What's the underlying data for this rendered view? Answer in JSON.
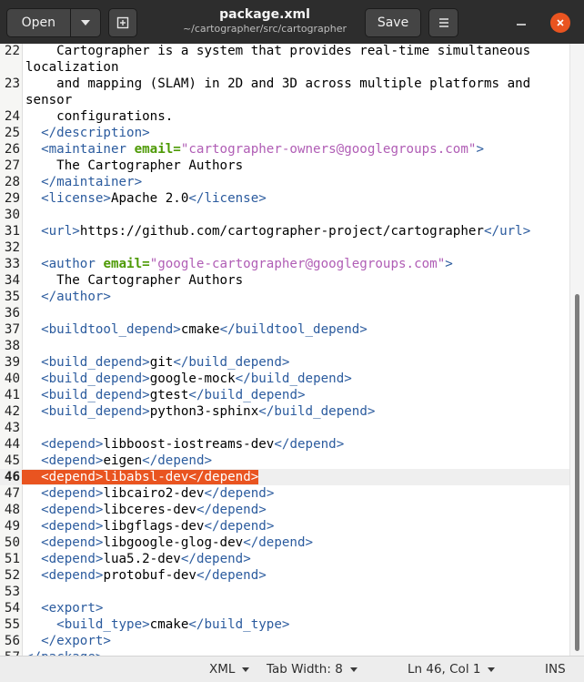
{
  "header": {
    "open_label": "Open",
    "save_label": "Save",
    "title": "package.xml",
    "subtitle": "~/cartographer/src/cartographer"
  },
  "editor": {
    "current_line": 46,
    "lines": [
      {
        "n": "22",
        "code": "    Cartographer is a system that provides real-time simultaneous"
      },
      {
        "n": "",
        "code": "localization"
      },
      {
        "n": "23",
        "code": "    and mapping (SLAM) in 2D and 3D across multiple platforms and"
      },
      {
        "n": "",
        "code": "sensor"
      },
      {
        "n": "24",
        "code": "    configurations."
      },
      {
        "n": "25",
        "code": "  </description>"
      },
      {
        "n": "26",
        "code": "  <maintainer email=\"cartographer-owners@googlegroups.com\">"
      },
      {
        "n": "27",
        "code": "    The Cartographer Authors"
      },
      {
        "n": "28",
        "code": "  </maintainer>"
      },
      {
        "n": "29",
        "code": "  <license>Apache 2.0</license>"
      },
      {
        "n": "30",
        "code": ""
      },
      {
        "n": "31",
        "code": "  <url>https://github.com/cartographer-project/cartographer</url>"
      },
      {
        "n": "32",
        "code": ""
      },
      {
        "n": "33",
        "code": "  <author email=\"google-cartographer@googlegroups.com\">"
      },
      {
        "n": "34",
        "code": "    The Cartographer Authors"
      },
      {
        "n": "35",
        "code": "  </author>"
      },
      {
        "n": "36",
        "code": ""
      },
      {
        "n": "37",
        "code": "  <buildtool_depend>cmake</buildtool_depend>"
      },
      {
        "n": "38",
        "code": ""
      },
      {
        "n": "39",
        "code": "  <build_depend>git</build_depend>"
      },
      {
        "n": "40",
        "code": "  <build_depend>google-mock</build_depend>"
      },
      {
        "n": "41",
        "code": "  <build_depend>gtest</build_depend>"
      },
      {
        "n": "42",
        "code": "  <build_depend>python3-sphinx</build_depend>"
      },
      {
        "n": "43",
        "code": ""
      },
      {
        "n": "44",
        "code": "  <depend>libboost-iostreams-dev</depend>"
      },
      {
        "n": "45",
        "code": "  <depend>eigen</depend>"
      },
      {
        "n": "46",
        "code": "  <depend>libabsl-dev</depend>"
      },
      {
        "n": "47",
        "code": "  <depend>libcairo2-dev</depend>"
      },
      {
        "n": "48",
        "code": "  <depend>libceres-dev</depend>"
      },
      {
        "n": "49",
        "code": "  <depend>libgflags-dev</depend>"
      },
      {
        "n": "50",
        "code": "  <depend>libgoogle-glog-dev</depend>"
      },
      {
        "n": "51",
        "code": "  <depend>lua5.2-dev</depend>"
      },
      {
        "n": "52",
        "code": "  <depend>protobuf-dev</depend>"
      },
      {
        "n": "53",
        "code": ""
      },
      {
        "n": "54",
        "code": "  <export>"
      },
      {
        "n": "55",
        "code": "    <build_type>cmake</build_type>"
      },
      {
        "n": "56",
        "code": "  </export>"
      },
      {
        "n": "57",
        "code": "</package>"
      }
    ]
  },
  "statusbar": {
    "language": "XML",
    "tab_width": "Tab Width: 8",
    "position": "Ln 46, Col 1",
    "mode": "INS"
  },
  "colors": {
    "accent": "#e95420",
    "tag": "#2b5b9e",
    "attribute": "#4e9a06",
    "string": "#b05db5"
  },
  "icons": {
    "open_dropdown": "chevron-down-icon",
    "new_tab": "new-document-icon",
    "menu": "hamburger-menu-icon",
    "minimize": "minimize-icon",
    "close": "close-icon"
  }
}
